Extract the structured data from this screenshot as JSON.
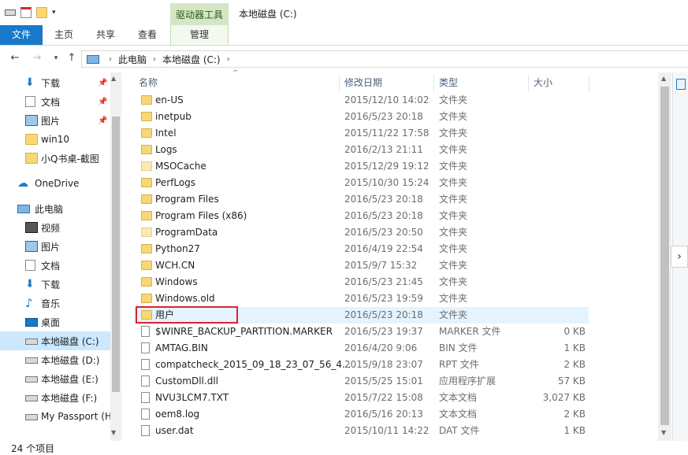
{
  "title_bar": {
    "context_tab": "驱动器工具",
    "window_title": "本地磁盘 (C:)"
  },
  "ribbon": {
    "tabs": [
      "文件",
      "主页",
      "共享",
      "查看"
    ],
    "manage_tab": "管理"
  },
  "address": {
    "path": [
      "此电脑",
      "本地磁盘 (C:)"
    ]
  },
  "nav": {
    "quick_access": [
      {
        "label": "下载",
        "icon": "download-arrow-icon",
        "pinned": true
      },
      {
        "label": "文档",
        "icon": "document-icon",
        "pinned": true
      },
      {
        "label": "图片",
        "icon": "picture-icon",
        "pinned": true
      },
      {
        "label": "win10",
        "icon": "folder-icon",
        "pinned": false
      },
      {
        "label": "小Q书桌-截图",
        "icon": "folder-icon",
        "pinned": false
      }
    ],
    "onedrive": "OneDrive",
    "this_pc": "此电脑",
    "pc_items": [
      {
        "label": "视频",
        "icon": "video-icon"
      },
      {
        "label": "图片",
        "icon": "picture-icon"
      },
      {
        "label": "文档",
        "icon": "document-icon"
      },
      {
        "label": "下载",
        "icon": "download-arrow-icon"
      },
      {
        "label": "音乐",
        "icon": "music-note-icon"
      },
      {
        "label": "桌面",
        "icon": "desktop-icon"
      },
      {
        "label": "本地磁盘 (C:)",
        "icon": "drive-icon",
        "selected": true
      },
      {
        "label": "本地磁盘 (D:)",
        "icon": "drive-icon"
      },
      {
        "label": "本地磁盘 (E:)",
        "icon": "drive-icon"
      },
      {
        "label": "本地磁盘 (F:)",
        "icon": "drive-icon"
      },
      {
        "label": "My Passport (H",
        "icon": "drive-icon"
      }
    ]
  },
  "columns": {
    "name": "名称",
    "date": "修改日期",
    "type": "类型",
    "size": "大小"
  },
  "files": [
    {
      "name": "en-US",
      "date": "2015/12/10 14:02",
      "type": "文件夹",
      "size": "",
      "kind": "folder"
    },
    {
      "name": "inetpub",
      "date": "2016/5/23 20:18",
      "type": "文件夹",
      "size": "",
      "kind": "folder"
    },
    {
      "name": "Intel",
      "date": "2015/11/22 17:58",
      "type": "文件夹",
      "size": "",
      "kind": "folder"
    },
    {
      "name": "Logs",
      "date": "2016/2/13 21:11",
      "type": "文件夹",
      "size": "",
      "kind": "folder"
    },
    {
      "name": "MSOCache",
      "date": "2015/12/29 19:12",
      "type": "文件夹",
      "size": "",
      "kind": "folder-light"
    },
    {
      "name": "PerfLogs",
      "date": "2015/10/30 15:24",
      "type": "文件夹",
      "size": "",
      "kind": "folder"
    },
    {
      "name": "Program Files",
      "date": "2016/5/23 20:18",
      "type": "文件夹",
      "size": "",
      "kind": "folder"
    },
    {
      "name": "Program Files (x86)",
      "date": "2016/5/23 20:18",
      "type": "文件夹",
      "size": "",
      "kind": "folder"
    },
    {
      "name": "ProgramData",
      "date": "2016/5/23 20:50",
      "type": "文件夹",
      "size": "",
      "kind": "folder-light"
    },
    {
      "name": "Python27",
      "date": "2016/4/19 22:54",
      "type": "文件夹",
      "size": "",
      "kind": "folder"
    },
    {
      "name": "WCH.CN",
      "date": "2015/9/7 15:32",
      "type": "文件夹",
      "size": "",
      "kind": "folder"
    },
    {
      "name": "Windows",
      "date": "2016/5/23 21:45",
      "type": "文件夹",
      "size": "",
      "kind": "folder"
    },
    {
      "name": "Windows.old",
      "date": "2016/5/23 19:59",
      "type": "文件夹",
      "size": "",
      "kind": "folder"
    },
    {
      "name": "用户",
      "date": "2016/5/23 20:18",
      "type": "文件夹",
      "size": "",
      "kind": "folder",
      "selected": true
    },
    {
      "name": "$WINRE_BACKUP_PARTITION.MARKER",
      "date": "2016/5/23 19:37",
      "type": "MARKER 文件",
      "size": "0 KB",
      "kind": "file"
    },
    {
      "name": "AMTAG.BIN",
      "date": "2016/4/20 9:06",
      "type": "BIN 文件",
      "size": "1 KB",
      "kind": "file"
    },
    {
      "name": "compatcheck_2015_09_18_23_07_56_4...",
      "date": "2015/9/18 23:07",
      "type": "RPT 文件",
      "size": "2 KB",
      "kind": "file"
    },
    {
      "name": "CustomDll.dll",
      "date": "2015/5/25 15:01",
      "type": "应用程序扩展",
      "size": "57 KB",
      "kind": "file"
    },
    {
      "name": "NVU3LCM7.TXT",
      "date": "2015/7/22 15:08",
      "type": "文本文档",
      "size": "3,027 KB",
      "kind": "file"
    },
    {
      "name": "oem8.log",
      "date": "2016/5/16 20:13",
      "type": "文本文档",
      "size": "2 KB",
      "kind": "file"
    },
    {
      "name": "user.dat",
      "date": "2015/10/11 14:22",
      "type": "DAT 文件",
      "size": "1 KB",
      "kind": "file"
    }
  ],
  "status": {
    "text": "24 个项目"
  },
  "colors": {
    "file_tab": "#1979ca",
    "context_tab": "#d5e6c7",
    "selection": "#cce8ff",
    "highlight_box": "#d9252b"
  }
}
